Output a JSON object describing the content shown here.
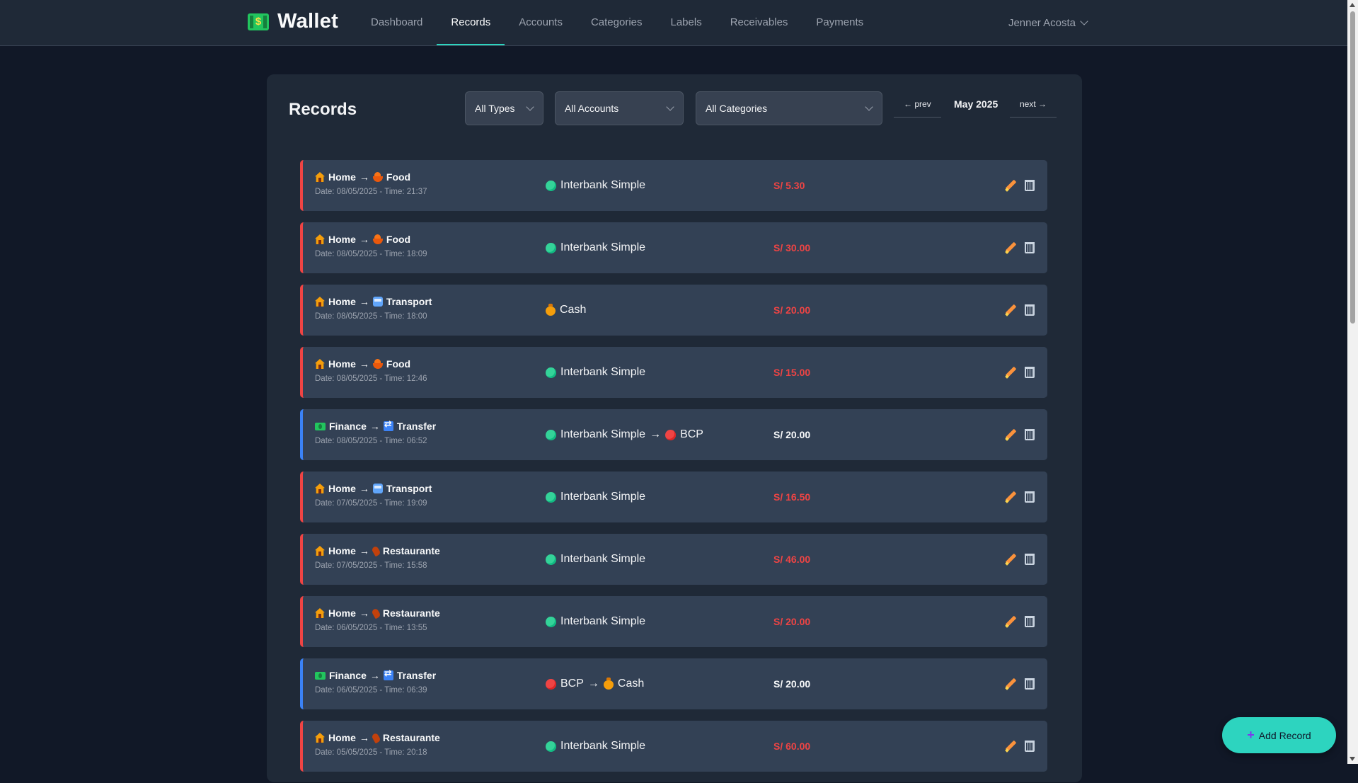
{
  "app": {
    "name": "Wallet",
    "logo_icon": "money-icon",
    "accent_color": "#2dd4bf"
  },
  "nav": {
    "items": [
      {
        "label": "Dashboard",
        "active": false
      },
      {
        "label": "Records",
        "active": true
      },
      {
        "label": "Accounts",
        "active": false
      },
      {
        "label": "Categories",
        "active": false
      },
      {
        "label": "Labels",
        "active": false
      },
      {
        "label": "Receivables",
        "active": false
      },
      {
        "label": "Payments",
        "active": false
      }
    ],
    "user_name": "Jenner Acosta"
  },
  "page": {
    "title": "Records",
    "filters": {
      "type": "All Types",
      "account": "All Accounts",
      "category": "All Categories"
    },
    "month_nav": {
      "prev_label": "← prev",
      "current": "May 2025",
      "next_label": "next →"
    }
  },
  "records": [
    {
      "kind": "expense",
      "parent": "Home",
      "parent_icon": "house-icon",
      "category": "Food",
      "category_icon": "bowl-icon",
      "date": "Date: 08/05/2025 - Time: 21:37",
      "from": "Interbank Simple",
      "from_icon": "green-dot",
      "to": null,
      "amount": "S/ 5.30"
    },
    {
      "kind": "expense",
      "parent": "Home",
      "parent_icon": "house-icon",
      "category": "Food",
      "category_icon": "bowl-icon",
      "date": "Date: 08/05/2025 - Time: 18:09",
      "from": "Interbank Simple",
      "from_icon": "green-dot",
      "to": null,
      "amount": "S/ 30.00"
    },
    {
      "kind": "expense",
      "parent": "Home",
      "parent_icon": "house-icon",
      "category": "Transport",
      "category_icon": "bus-icon",
      "date": "Date: 08/05/2025 - Time: 18:00",
      "from": "Cash",
      "from_icon": "money-bag",
      "to": null,
      "amount": "S/ 20.00"
    },
    {
      "kind": "expense",
      "parent": "Home",
      "parent_icon": "house-icon",
      "category": "Food",
      "category_icon": "bowl-icon",
      "date": "Date: 08/05/2025 - Time: 12:46",
      "from": "Interbank Simple",
      "from_icon": "green-dot",
      "to": null,
      "amount": "S/ 15.00"
    },
    {
      "kind": "transfer",
      "parent": "Finance",
      "parent_icon": "money-icon",
      "category": "Transfer",
      "category_icon": "transfer-icon",
      "date": "Date: 08/05/2025 - Time: 06:52",
      "from": "Interbank Simple",
      "from_icon": "green-dot",
      "to": "BCP",
      "to_icon": "red-dot",
      "amount": "S/ 20.00"
    },
    {
      "kind": "expense",
      "parent": "Home",
      "parent_icon": "house-icon",
      "category": "Transport",
      "category_icon": "bus-icon",
      "date": "Date: 07/05/2025 - Time: 19:09",
      "from": "Interbank Simple",
      "from_icon": "green-dot",
      "to": null,
      "amount": "S/ 16.50"
    },
    {
      "kind": "expense",
      "parent": "Home",
      "parent_icon": "house-icon",
      "category": "Restaurante",
      "category_icon": "drumstick-icon",
      "date": "Date: 07/05/2025 - Time: 15:58",
      "from": "Interbank Simple",
      "from_icon": "green-dot",
      "to": null,
      "amount": "S/ 46.00"
    },
    {
      "kind": "expense",
      "parent": "Home",
      "parent_icon": "house-icon",
      "category": "Restaurante",
      "category_icon": "drumstick-icon",
      "date": "Date: 06/05/2025 - Time: 13:55",
      "from": "Interbank Simple",
      "from_icon": "green-dot",
      "to": null,
      "amount": "S/ 20.00"
    },
    {
      "kind": "transfer",
      "parent": "Finance",
      "parent_icon": "money-icon",
      "category": "Transfer",
      "category_icon": "transfer-icon",
      "date": "Date: 06/05/2025 - Time: 06:39",
      "from": "BCP",
      "from_icon": "red-dot",
      "to": "Cash",
      "to_icon": "money-bag",
      "amount": "S/ 20.00"
    },
    {
      "kind": "expense",
      "parent": "Home",
      "parent_icon": "house-icon",
      "category": "Restaurante",
      "category_icon": "drumstick-icon",
      "date": "Date: 05/05/2025 - Time: 20:18",
      "from": "Interbank Simple",
      "from_icon": "green-dot",
      "to": null,
      "amount": "S/ 60.00"
    }
  ],
  "colors": {
    "expense": "#ef4444",
    "transfer": "#3b82f6",
    "panel": "#1f2937",
    "row": "#334155"
  },
  "fab": {
    "label": "Add Record",
    "icon": "plus-icon"
  }
}
